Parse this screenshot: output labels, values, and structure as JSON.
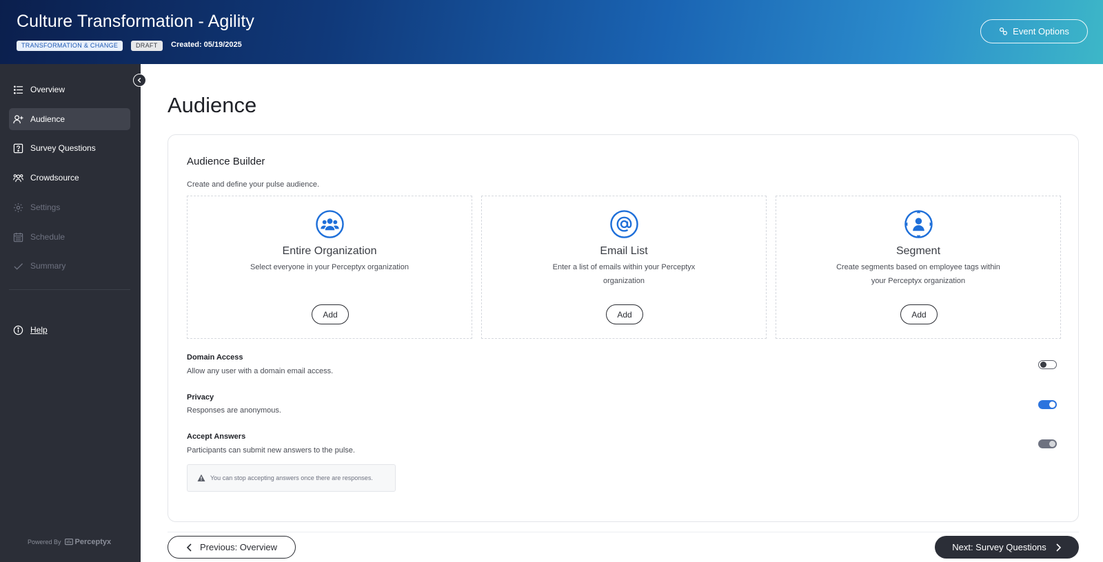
{
  "header": {
    "title": "Culture Transformation - Agility",
    "badge_category": "TRANSFORMATION & CHANGE",
    "badge_status": "DRAFT",
    "created": "Created: 05/19/2025",
    "event_options_label": "Event Options"
  },
  "sidebar": {
    "items": [
      {
        "label": "Overview",
        "icon": "list-icon",
        "state": "normal"
      },
      {
        "label": "Audience",
        "icon": "user-plus-icon",
        "state": "active"
      },
      {
        "label": "Survey Questions",
        "icon": "question-square-icon",
        "state": "normal"
      },
      {
        "label": "Crowdsource",
        "icon": "users-icon",
        "state": "normal"
      },
      {
        "label": "Settings",
        "icon": "gear-icon",
        "state": "disabled"
      },
      {
        "label": "Schedule",
        "icon": "calendar-icon",
        "state": "disabled"
      },
      {
        "label": "Summary",
        "icon": "check-icon",
        "state": "disabled"
      }
    ],
    "help_label": "Help",
    "powered_by": "Powered By",
    "brand": "Perceptyx"
  },
  "main": {
    "page_title": "Audience",
    "builder": {
      "title": "Audience Builder",
      "subtitle": "Create and define your pulse audience.",
      "options": [
        {
          "title": "Entire Organization",
          "description": "Select everyone in your Perceptyx organization",
          "button": "Add",
          "icon": "group-icon"
        },
        {
          "title": "Email List",
          "description": "Enter a list of emails within your Perceptyx organization",
          "button": "Add",
          "icon": "at-sign-icon"
        },
        {
          "title": "Segment",
          "description": "Create segments based on employee tags within your Perceptyx organization",
          "button": "Add",
          "icon": "user-target-icon"
        }
      ]
    },
    "settings": [
      {
        "label": "Domain Access",
        "description": "Allow any user with a domain email access.",
        "enabled": false
      },
      {
        "label": "Privacy",
        "description": "Responses are anonymous.",
        "enabled": true
      },
      {
        "label": "Accept Answers",
        "description": "Participants can submit new answers to the pulse.",
        "enabled": true,
        "locked": true
      }
    ],
    "notice": "You can stop accepting answers once there are responses."
  },
  "footer": {
    "previous_label": "Previous: Overview",
    "next_label": "Next: Survey Questions"
  },
  "colors": {
    "accent_blue": "#2c74de",
    "sidebar_bg": "#2b2e37",
    "icon_blue": "#1e6fd9"
  }
}
